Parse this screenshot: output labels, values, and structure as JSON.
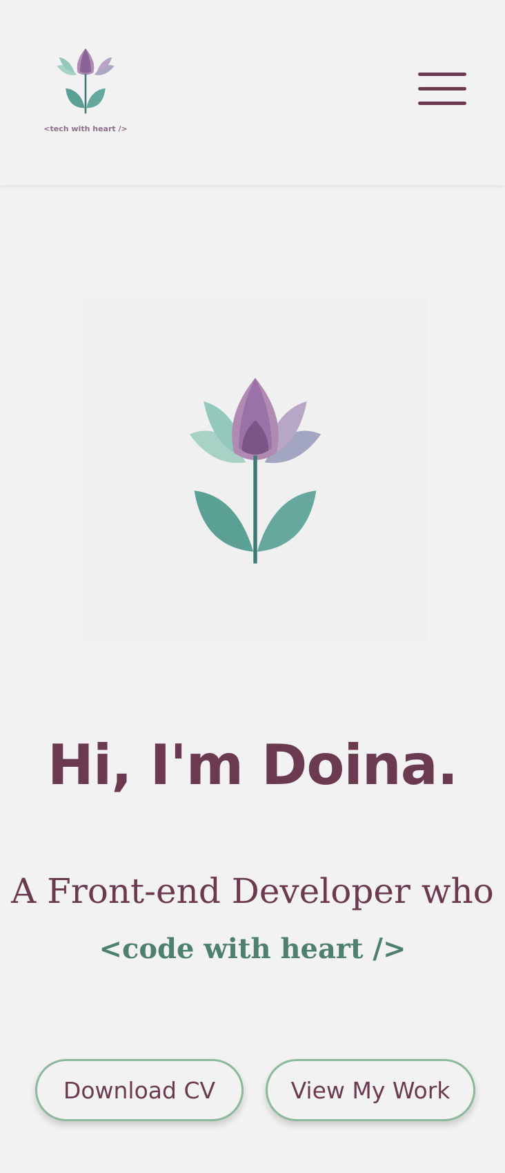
{
  "header": {
    "logo_text": "<tech with heart />",
    "logo_icon": "lotus-flower-icon",
    "menu_icon": "hamburger-menu-icon"
  },
  "hero": {
    "image_icon": "lotus-flower-icon",
    "greeting": "Hi, I'm Doina.",
    "tagline": "A Front-end Developer who",
    "tagline_code": "<code with heart />"
  },
  "actions": {
    "download_cv_label": "Download CV",
    "view_work_label": "View My Work"
  },
  "colors": {
    "background": "#f2f2f2",
    "primary_plum": "#6b3a50",
    "accent_green": "#4e8070",
    "button_border": "#8cb89c"
  }
}
